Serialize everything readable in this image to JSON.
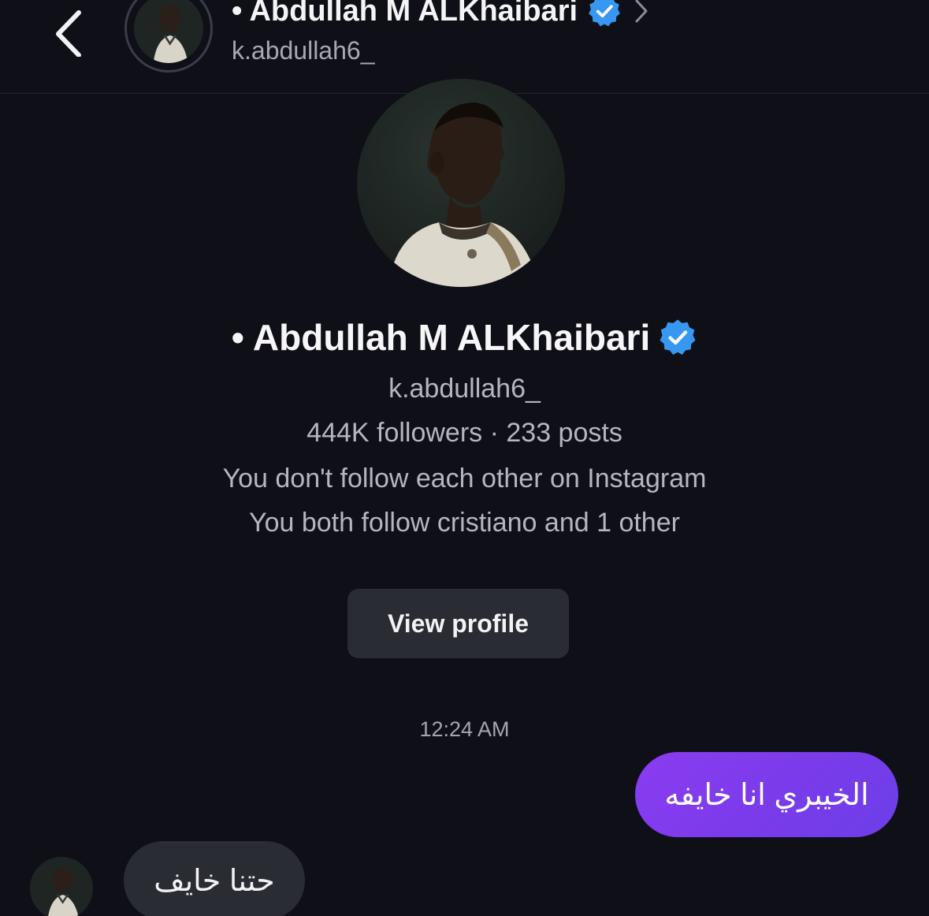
{
  "header": {
    "name": "• Abdullah M ALKhaibari",
    "username": "k.abdullah6_"
  },
  "profile": {
    "name": "• Abdullah M ALKhaibari",
    "username": "k.abdullah6_",
    "stats": "444K followers · 233 posts",
    "follow_status": "You don't follow each other on Instagram",
    "mutual": "You both follow cristiano and 1 other",
    "view_profile_label": "View profile"
  },
  "thread": {
    "timestamp": "12:24 AM",
    "messages": [
      {
        "direction": "sent",
        "text": "الخيبري انا خايفه"
      },
      {
        "direction": "received",
        "text": "حتنا خايف"
      }
    ]
  },
  "colors": {
    "background": "#0f1017",
    "verified_badge": "#3897f0",
    "sent_bubble": "#7a3bea",
    "received_bubble": "#2a2c33",
    "button": "#2a2c33"
  },
  "icons": {
    "back": "chevron-left-icon",
    "verified": "verified-badge-icon",
    "open_chevron": "chevron-right-icon"
  }
}
